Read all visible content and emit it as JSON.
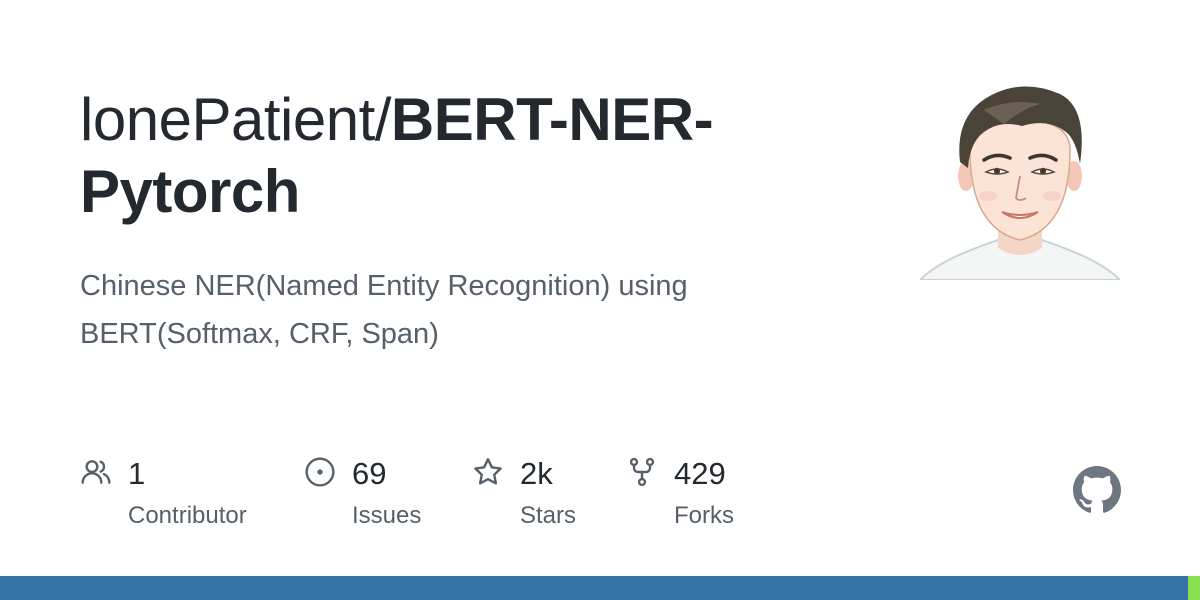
{
  "repo": {
    "owner": "lonePatient/",
    "name_line1": "BERT-NER-",
    "name_line2": "Pytorch",
    "description_line1": "Chinese NER(Named Entity Recognition) using",
    "description_line2": "BERT(Softmax, CRF, Span)"
  },
  "stats": [
    {
      "icon": "people-icon",
      "value": "1",
      "label": "Contributor"
    },
    {
      "icon": "issue-opened-icon",
      "value": "69",
      "label": "Issues"
    },
    {
      "icon": "star-icon",
      "value": "2k",
      "label": "Stars"
    },
    {
      "icon": "repo-forked-icon",
      "value": "429",
      "label": "Forks"
    }
  ],
  "language_bar": {
    "segments": [
      {
        "color": "#3572A5",
        "share": 0.99
      },
      {
        "color": "#89e051",
        "share": 0.01
      }
    ]
  },
  "colors": {
    "text_primary": "#24292f",
    "text_secondary": "#57606a",
    "icon": "#57606a",
    "github_logo": "#6e7781"
  }
}
